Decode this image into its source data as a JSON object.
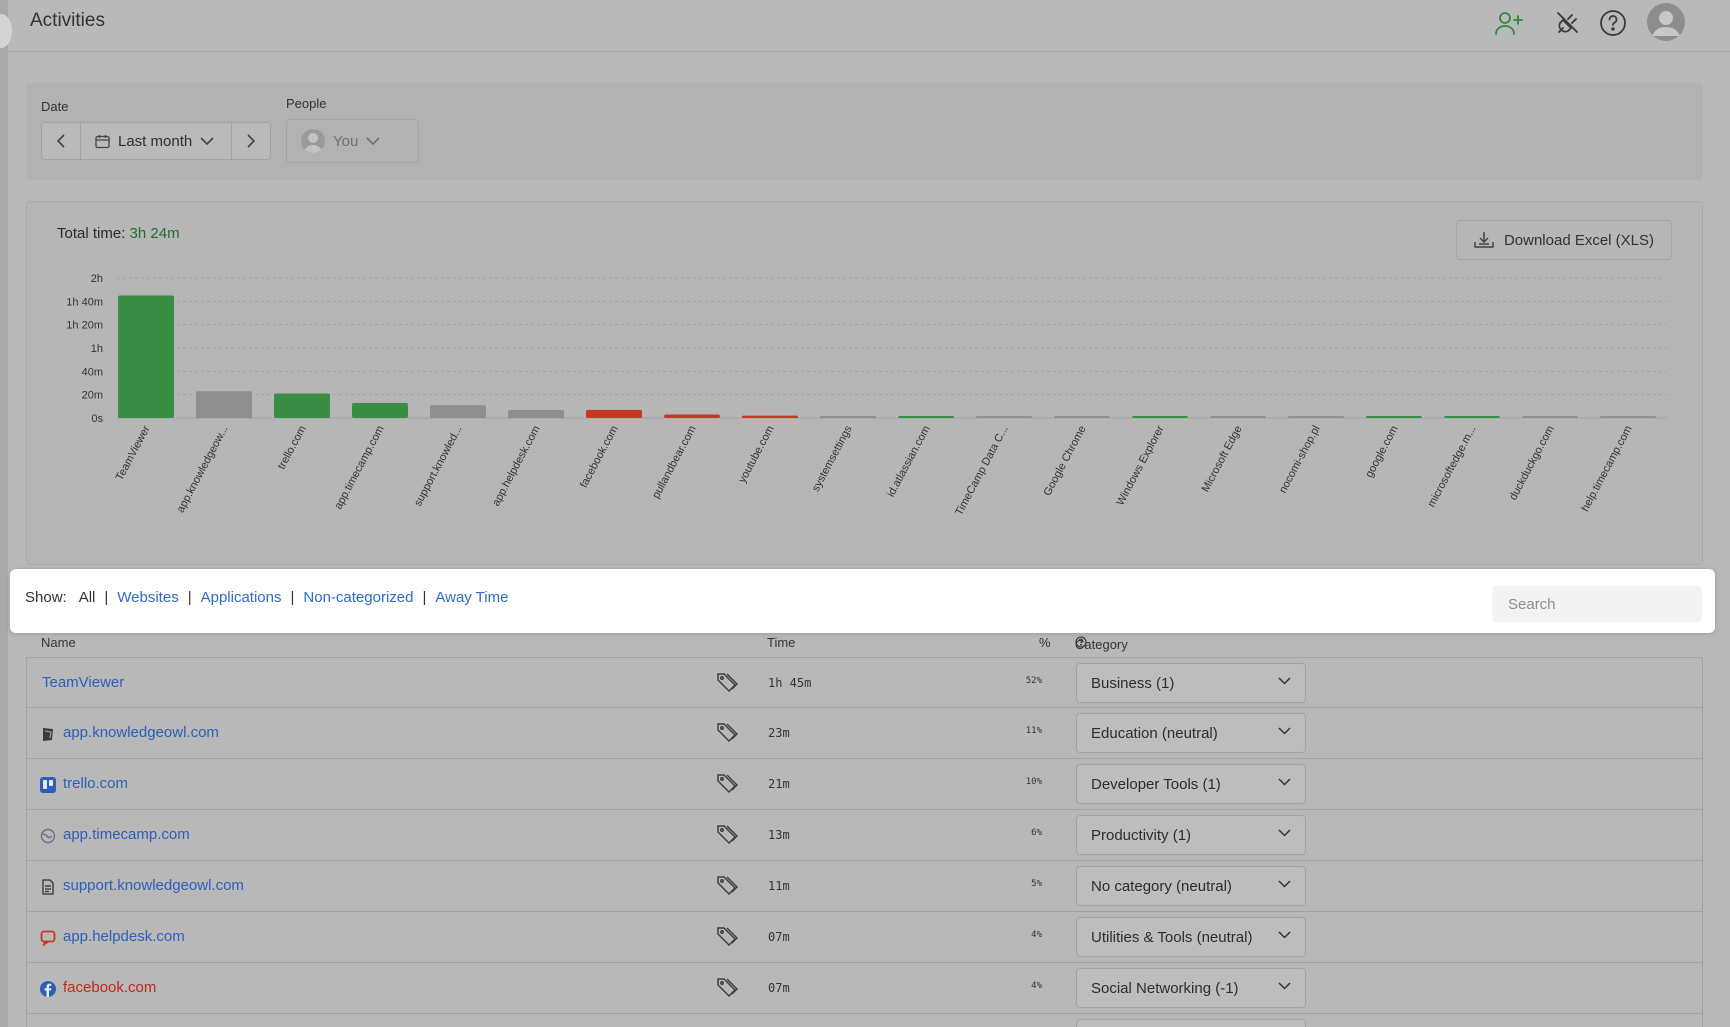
{
  "header": {
    "title": "Activities"
  },
  "filters": {
    "date_label": "Date",
    "date_value": "Last month",
    "people_label": "People",
    "people_value": "You"
  },
  "summary": {
    "total_label": "Total time:",
    "total_value": "3h 24m",
    "download_label": "Download Excel (XLS)"
  },
  "chart_data": {
    "type": "bar",
    "categories": [
      "TeamViewer",
      "app.knowledgeow...",
      "trello.com",
      "app.timecamp.com",
      "support.knowled...",
      "app.helpdesk.com",
      "facebook.com",
      "pullandbear.com",
      "youtube.com",
      "systemsettings",
      "id.atlassian.com",
      "TimeCamp Data C...",
      "Google Chrome",
      "Windows Explorer",
      "Microsoft Edge",
      "nocomi-shop.pl",
      "google.com",
      "microsoftedge.m...",
      "duckduckgo.com",
      "help.timecamp.com"
    ],
    "values": [
      105,
      23,
      21,
      13,
      11,
      7,
      7,
      3,
      2,
      1.5,
      1.5,
      1,
      0.5,
      0.5,
      0.4,
      0.4,
      0.4,
      0.3,
      0.3,
      0.3
    ],
    "value_unit": "minutes",
    "bar_colors": [
      "#3a8d44",
      "#8f8f8f",
      "#3a8d44",
      "#3a8d44",
      "#8f8f8f",
      "#8f8f8f",
      "#c8371f",
      "#c8371f",
      "#c8371f",
      "#8f8f8f",
      "#3a8d44",
      "#8f8f8f",
      "#8f8f8f",
      "#3a8d44",
      "#8f8f8f",
      "#8f8f8f",
      "#3a8d44",
      "#3a8d44",
      "#8f8f8f",
      "#8f8f8f"
    ],
    "y_ticks": [
      "0s",
      "20m",
      "40m",
      "1h",
      "1h 20m",
      "1h 40m",
      "2h"
    ],
    "ylim": [
      0,
      120
    ],
    "grid": true
  },
  "show": {
    "label": "Show:",
    "all": "All",
    "sep": "|",
    "links": [
      "Websites",
      "Applications",
      "Non-categorized",
      "Away Time"
    ],
    "search_placeholder": "Search"
  },
  "table": {
    "headers": {
      "name": "Name",
      "time": "Time",
      "percent": "%",
      "category": "Category"
    },
    "rows": [
      {
        "name": "TeamViewer",
        "time": "1h 45m",
        "percent": "52%",
        "category": "Business (1)",
        "icon": "none",
        "name_color": "#2d5fb8"
      },
      {
        "name": "app.knowledgeowl.com",
        "time": "23m",
        "percent": "11%",
        "category": "Education (neutral)",
        "icon": "owl-icon",
        "name_color": "#2d5fb8"
      },
      {
        "name": "trello.com",
        "time": "21m",
        "percent": "10%",
        "category": "Developer Tools (1)",
        "icon": "trello-icon",
        "name_color": "#2d5fb8"
      },
      {
        "name": "app.timecamp.com",
        "time": "13m",
        "percent": "6%",
        "category": "Productivity (1)",
        "icon": "globe-icon",
        "name_color": "#2d5fb8"
      },
      {
        "name": "support.knowledgeowl.com",
        "time": "11m",
        "percent": "5%",
        "category": "No category (neutral)",
        "icon": "document-icon",
        "name_color": "#2d5fb8"
      },
      {
        "name": "app.helpdesk.com",
        "time": "07m",
        "percent": "4%",
        "category": "Utilities & Tools (neutral)",
        "icon": "chat-icon",
        "name_color": "#2d5fb8"
      },
      {
        "name": "facebook.com",
        "time": "07m",
        "percent": "4%",
        "category": "Social Networking (-1)",
        "icon": "facebook-icon",
        "name_color": "#c0261c"
      }
    ]
  }
}
